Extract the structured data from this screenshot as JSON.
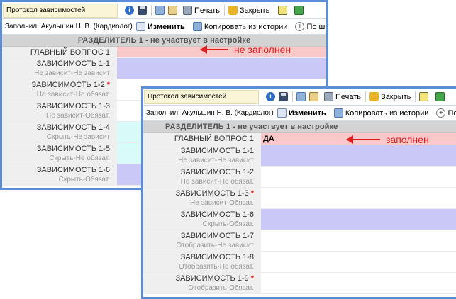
{
  "window1": {
    "title": "Протокол зависимостей",
    "toolbar": {
      "print": "Печать",
      "close": "Закрыть"
    },
    "subbar": {
      "filled_by": "Заполнил: Акульшин Н. В. (Кардиолог)",
      "edit": "Изменить",
      "copy_history": "Копировать из истории",
      "by_template": "По шаблону"
    },
    "section": "РАЗДЕЛИТЕЛЬ 1 - не участвует в настройке",
    "rows": [
      {
        "main": "ГЛАВНЫЙ ВОПРОС 1",
        "sub": "",
        "required": false,
        "value": ""
      },
      {
        "main": "ЗАВИСИМОСТЬ 1-1",
        "sub": "Не зависит-Не зависит",
        "required": false,
        "value": ""
      },
      {
        "main": "ЗАВИСИМОСТЬ 1-2",
        "sub": "Не зависит-Не обязат.",
        "required": true,
        "value": ""
      },
      {
        "main": "ЗАВИСИМОСТЬ 1-3",
        "sub": "Не зависит-Обязат.",
        "required": false,
        "value": ""
      },
      {
        "main": "ЗАВИСИМОСТЬ 1-4",
        "sub": "Скрыть-Не зависит",
        "required": false,
        "value": ""
      },
      {
        "main": "ЗАВИСИМОСТЬ 1-5",
        "sub": "Скрыть-Не обязат.",
        "required": false,
        "value": ""
      },
      {
        "main": "ЗАВИСИМОСТЬ 1-6",
        "sub": "Скрыть-Обязат.",
        "required": false,
        "value": ""
      }
    ],
    "annotation": "не заполнен"
  },
  "window2": {
    "title": "Протокол зависимостей",
    "toolbar": {
      "print": "Печать",
      "close": "Закрыть"
    },
    "subbar": {
      "filled_by": "Заполнил: Акульшин Н. В. (Кардиолог)",
      "edit": "Изменить",
      "copy_history": "Копировать из истории",
      "by_template": "По шаблону"
    },
    "section": "РАЗДЕЛИТЕЛЬ 1 - не участвует в настройке",
    "rows": [
      {
        "main": "ГЛАВНЫЙ ВОПРОС 1",
        "sub": "",
        "required": false,
        "value": "ДА"
      },
      {
        "main": "ЗАВИСИМОСТЬ 1-1",
        "sub": "Не зависит-Не зависит",
        "required": false,
        "value": ""
      },
      {
        "main": "ЗАВИСИМОСТЬ 1-2",
        "sub": "Не зависит-Не обязат.",
        "required": false,
        "value": ""
      },
      {
        "main": "ЗАВИСИМОСТЬ 1-3",
        "sub": "Не зависит-Обязат.",
        "required": true,
        "value": ""
      },
      {
        "main": "ЗАВИСИМОСТЬ 1-6",
        "sub": "Скрыть-Обязат.",
        "required": false,
        "value": ""
      },
      {
        "main": "ЗАВИСИМОСТЬ 1-7",
        "sub": "Отобразить-Не зависит",
        "required": false,
        "value": ""
      },
      {
        "main": "ЗАВИСИМОСТЬ 1-8",
        "sub": "Отобразить-Не обязат.",
        "required": false,
        "value": ""
      },
      {
        "main": "ЗАВИСИМОСТЬ 1-9",
        "sub": "Отобразить-Обязат.",
        "required": true,
        "value": ""
      }
    ],
    "annotation": "заполнен"
  },
  "colors": {
    "window_border": "#5c8ed8",
    "not_filled": "#f9c9c9",
    "empty_required_hint": "#c9c8f7",
    "hidden_row": "#d8faf9",
    "required_marker": "#e02020",
    "annotation": "#e02020"
  },
  "icons": [
    "info-icon",
    "save-icon",
    "copy-icon",
    "paste-icon",
    "printer-icon",
    "lock-icon",
    "notepad-icon",
    "exit-icon",
    "edit-icon",
    "copy-history-icon",
    "add-template-icon"
  ]
}
